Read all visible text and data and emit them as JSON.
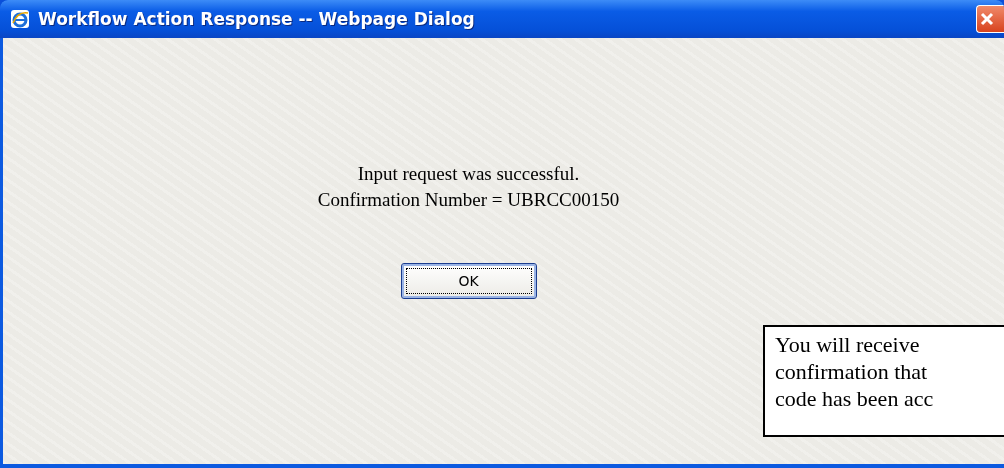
{
  "window": {
    "title": "Workflow Action Response -- Webpage Dialog"
  },
  "messages": [
    "Input request was successful.",
    "Confirmation Number = UBRCC00150"
  ],
  "buttons": [
    {
      "label": "OK",
      "focused": true
    }
  ],
  "callout": {
    "lines": [
      "You will receive",
      "confirmation that",
      "code has been acc"
    ]
  }
}
